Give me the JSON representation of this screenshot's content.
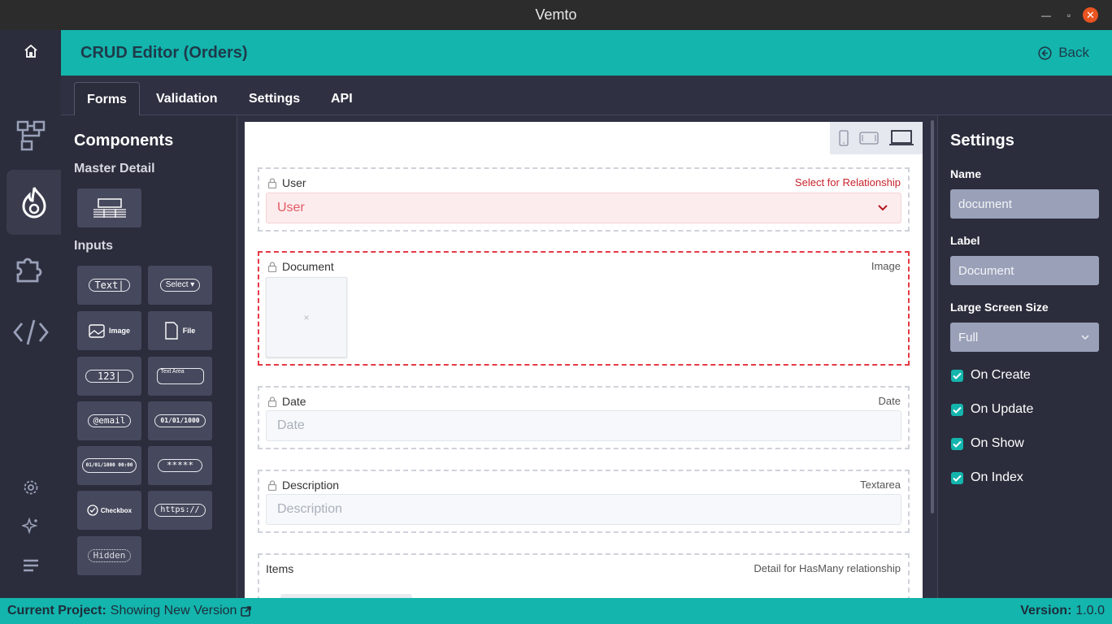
{
  "window": {
    "title": "Vemto"
  },
  "header": {
    "title": "CRUD Editor (Orders)",
    "back_label": "Back"
  },
  "tabs": [
    {
      "label": "Forms",
      "active": true
    },
    {
      "label": "Validation",
      "active": false
    },
    {
      "label": "Settings",
      "active": false
    },
    {
      "label": "API",
      "active": false
    }
  ],
  "iconbar": [
    "home-icon",
    "schema-icon",
    "crud-fire-icon",
    "plugin-puzzle-icon",
    "code-icon",
    "settings-gear-icon",
    "sparkle-icon",
    "menu-lines-icon"
  ],
  "components": {
    "title": "Components",
    "master_detail_label": "Master Detail",
    "inputs_label": "Inputs",
    "items": [
      {
        "label": "Text|",
        "name": "text"
      },
      {
        "label": "Select ▾",
        "name": "select"
      },
      {
        "label": "Image",
        "name": "image"
      },
      {
        "label": "File",
        "name": "file"
      },
      {
        "label": "123|",
        "name": "number"
      },
      {
        "label": "Text Area",
        "name": "textarea"
      },
      {
        "label": "@email",
        "name": "email"
      },
      {
        "label": "01/01/1000",
        "name": "date"
      },
      {
        "label": "01/01/1000 00:00",
        "name": "datetime"
      },
      {
        "label": "*****",
        "name": "password"
      },
      {
        "label": "Checkbox",
        "name": "checkbox"
      },
      {
        "label": "https://",
        "name": "url"
      },
      {
        "label": "Hidden",
        "name": "hidden"
      }
    ]
  },
  "form": {
    "fields": [
      {
        "label": "User",
        "type": "Select for Relationship",
        "placeholder": "User"
      },
      {
        "label": "Document",
        "type": "Image",
        "placeholder": "×"
      },
      {
        "label": "Date",
        "type": "Date",
        "placeholder": "Date"
      },
      {
        "label": "Description",
        "type": "Textarea",
        "placeholder": "Description"
      },
      {
        "label": "Items",
        "type": "Detail for HasMany relationship"
      }
    ]
  },
  "settings": {
    "title": "Settings",
    "name_label": "Name",
    "name_value": "document",
    "label_label": "Label",
    "label_value": "Document",
    "size_label": "Large Screen Size",
    "size_value": "Full",
    "checks": [
      {
        "label": "On Create",
        "checked": true
      },
      {
        "label": "On Update",
        "checked": true
      },
      {
        "label": "On Show",
        "checked": true
      },
      {
        "label": "On Index",
        "checked": true
      }
    ]
  },
  "status": {
    "project_label": "Current Project:",
    "project_value": "Showing New Version",
    "version_label": "Version:",
    "version_value": "1.0.0"
  },
  "colors": {
    "accent": "#13b5ad",
    "danger": "#e53946",
    "panel": "#2b2d3c"
  }
}
